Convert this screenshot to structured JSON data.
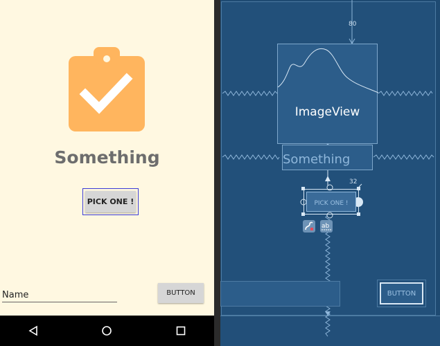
{
  "phone": {
    "title": "Something",
    "pick_button_label": "PICK ONE !",
    "name_value": "Name",
    "button_label": "BUTTON",
    "colors": {
      "background": "#fff8e1",
      "icon": "#ffb55e",
      "title": "#6d6d6d"
    }
  },
  "blueprint": {
    "imageview_label": "ImageView",
    "textview_label": "Something",
    "pick_button_label": "PICK ONE !",
    "button_label": "BUTTON",
    "margin_top": "80",
    "margin_right": "32",
    "colors": {
      "background": "#1e4a72",
      "line": "#8fb7db"
    }
  }
}
